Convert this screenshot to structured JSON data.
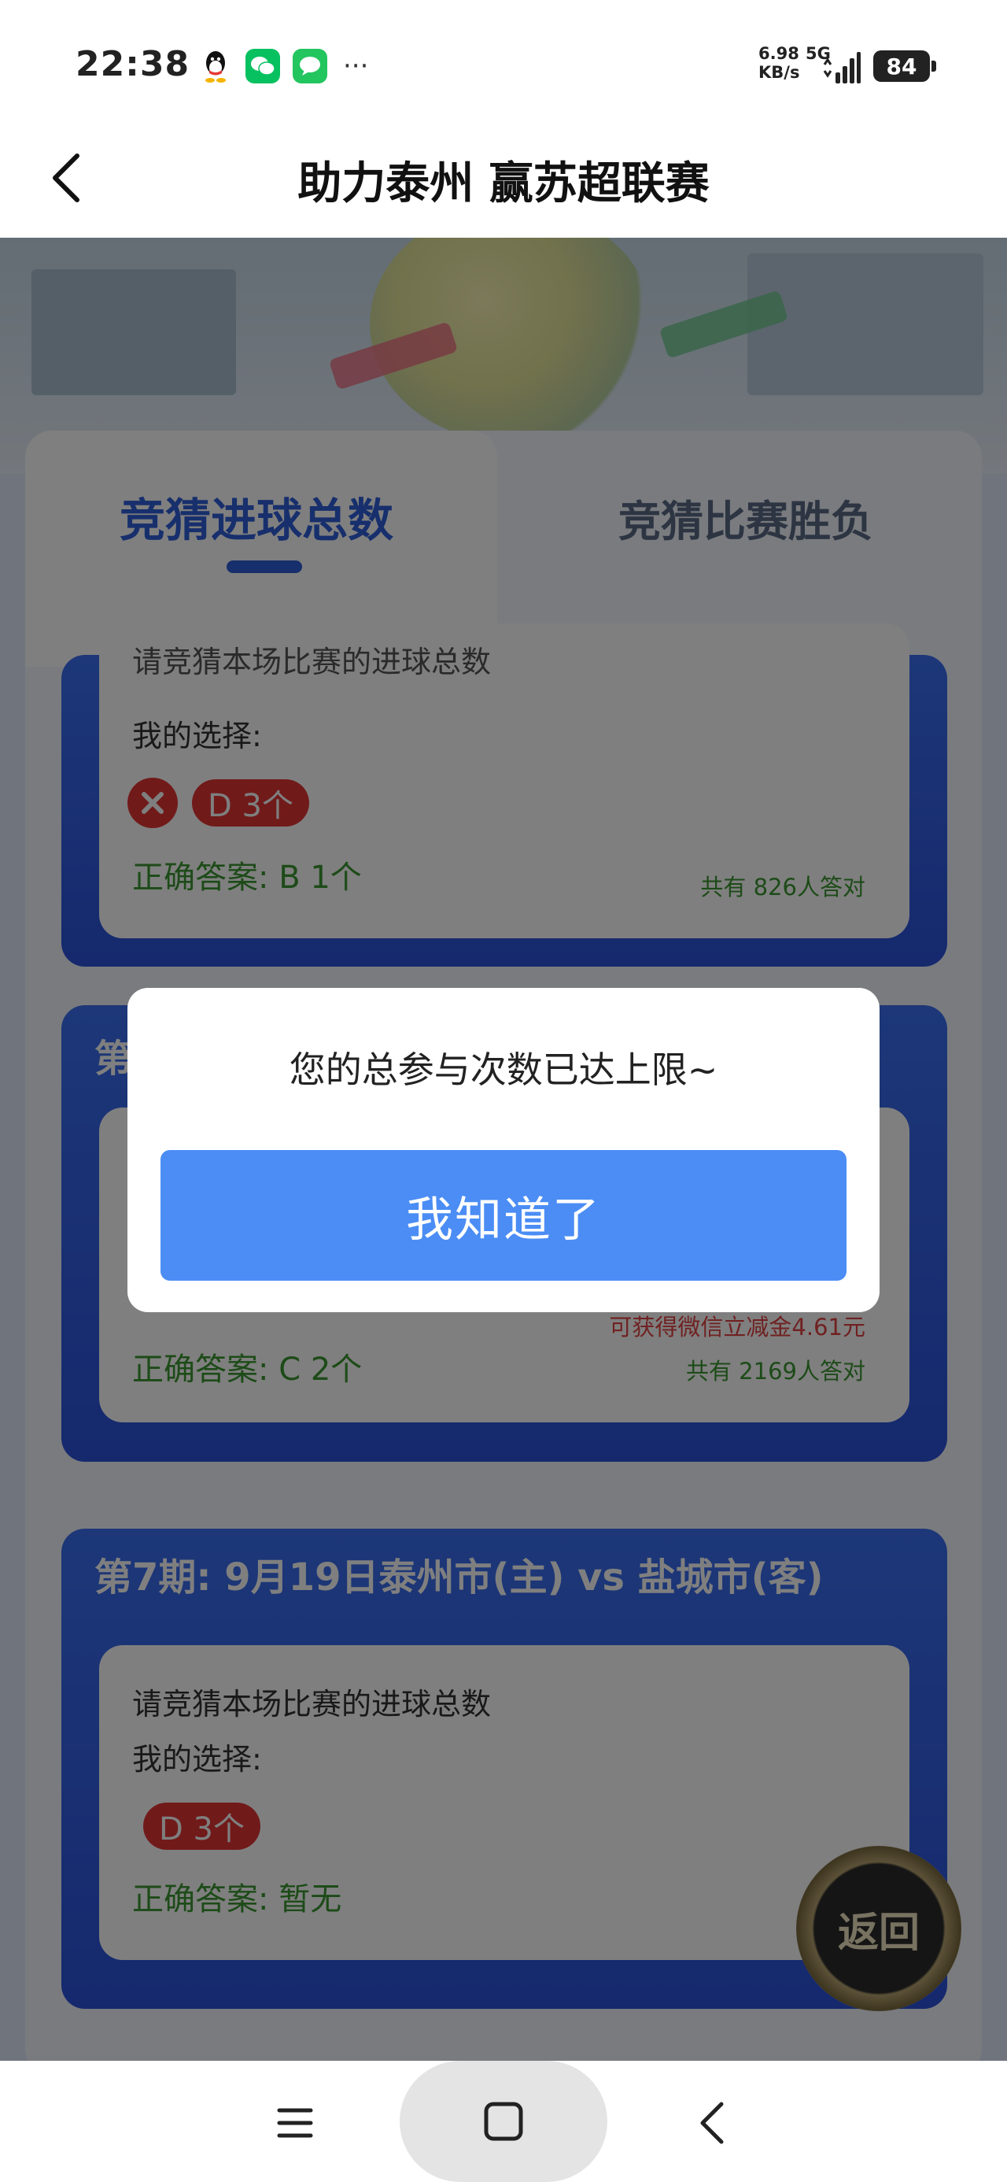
{
  "status_bar": {
    "time": "22:38",
    "net_speed_value": "6.98",
    "net_speed_unit": "KB/s",
    "network": "5G",
    "battery": "84",
    "more": "···",
    "app_icons": [
      "qq-icon",
      "wechat-icon",
      "message-icon"
    ]
  },
  "nav": {
    "title": "助力泰州 赢苏超联赛"
  },
  "tabs": [
    {
      "label": "竞猜进球总数",
      "active": true
    },
    {
      "label": "竞猜比赛胜负",
      "active": false
    }
  ],
  "cards": [
    {
      "question_partial": "请竞猜本场比赛的进球总数",
      "my_choice_label": "我的选择:",
      "choice": "D 3个",
      "result": "wrong",
      "correct_answer": "正确答案: B 1个",
      "correct_count": "共有 826人答对"
    },
    {
      "header_partial": "第",
      "correct_answer": "正确答案: C 2个",
      "reward": "可获得微信立减金4.61元",
      "correct_count": "共有 2169人答对"
    },
    {
      "header": "第7期: 9月19日泰州市(主) vs 盐城市(客)",
      "question": "请竞猜本场比赛的进球总数",
      "my_choice_label": "我的选择:",
      "choice": "D 3个",
      "correct_answer": "正确答案: 暂无"
    }
  ],
  "float_button": {
    "label": "返回"
  },
  "dialog": {
    "message": "您的总参与次数已达上限~",
    "button_label": "我知道了"
  },
  "colors": {
    "primary": "#2f5fd9",
    "dialog_button": "#4b8df5",
    "wrong": "#e23434",
    "correct_text": "#3b9631"
  }
}
